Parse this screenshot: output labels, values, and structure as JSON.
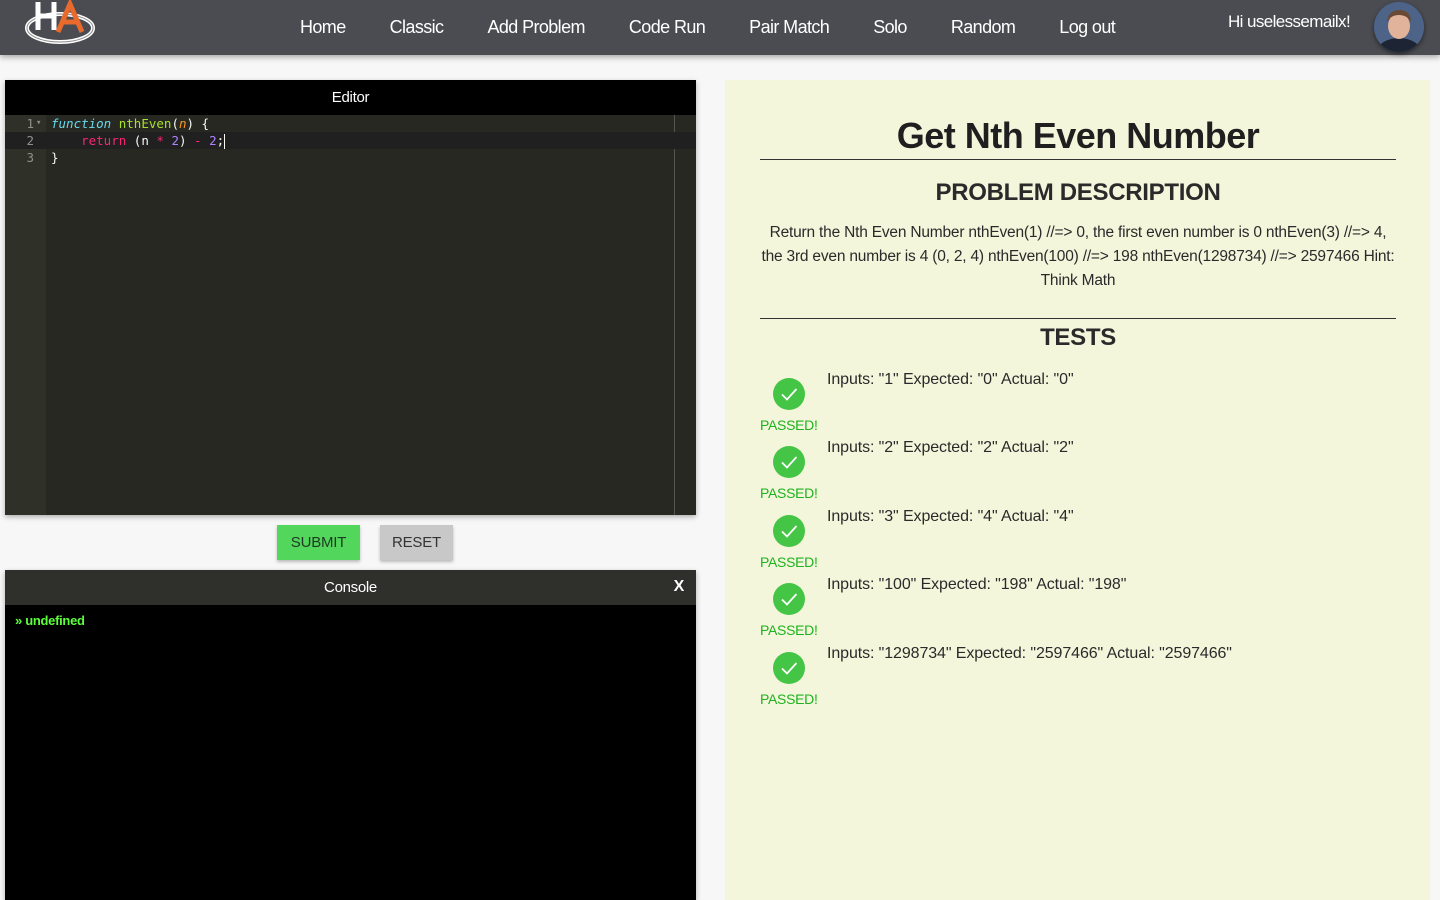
{
  "nav": {
    "items": [
      {
        "label": "Home"
      },
      {
        "label": "Classic"
      },
      {
        "label": "Add Problem"
      },
      {
        "label": "Code Run"
      },
      {
        "label": "Pair Match"
      },
      {
        "label": "Solo"
      },
      {
        "label": "Random"
      },
      {
        "label": "Log out"
      }
    ],
    "greeting": "Hi uselessemailx!",
    "logo_text": "HA"
  },
  "editor": {
    "header": "Editor",
    "line_numbers": [
      "1",
      "2",
      "3"
    ],
    "line1": {
      "kw": "function",
      "name": "nthEven",
      "open": "(",
      "param": "n",
      "close": ") {"
    },
    "line2": {
      "indent": "    ",
      "kw": "return",
      "a": " (n ",
      "op1": "*",
      "b": " ",
      "n1": "2",
      "c": ") ",
      "op2": "-",
      "d": " ",
      "n2": "2",
      "e": ";"
    },
    "line3": {
      "text": "}"
    }
  },
  "buttons": {
    "submit": "SUBMIT",
    "reset": "RESET"
  },
  "console": {
    "header": "Console",
    "close": "X",
    "output": "» undefined"
  },
  "problem": {
    "title": "Get Nth Even Number",
    "description_heading": "PROBLEM DESCRIPTION",
    "description": "Return the Nth Even Number nthEven(1) //=> 0, the first even number is 0 nthEven(3) //=> 4, the 3rd even number is 4 (0, 2, 4) nthEven(100) //=> 198 nthEven(1298734) //=> 2597466 Hint: Think Math",
    "tests_heading": "TESTS",
    "tests": [
      {
        "text": "Inputs: \"1\" Expected: \"0\" Actual: \"0\"",
        "status": "PASSED!"
      },
      {
        "text": "Inputs: \"2\" Expected: \"2\" Actual: \"2\"",
        "status": "PASSED!"
      },
      {
        "text": "Inputs: \"3\" Expected: \"4\" Actual: \"4\"",
        "status": "PASSED!"
      },
      {
        "text": "Inputs: \"100\" Expected: \"198\" Actual: \"198\"",
        "status": "PASSED!"
      },
      {
        "text": "Inputs: \"1298734\" Expected: \"2597466\" Actual: \"2597466\"",
        "status": "PASSED!"
      }
    ]
  },
  "colors": {
    "topbar": "#4a4c52",
    "submit": "#52d65c",
    "passed": "#1db31d",
    "problem_bg": "#f4f6dc"
  }
}
